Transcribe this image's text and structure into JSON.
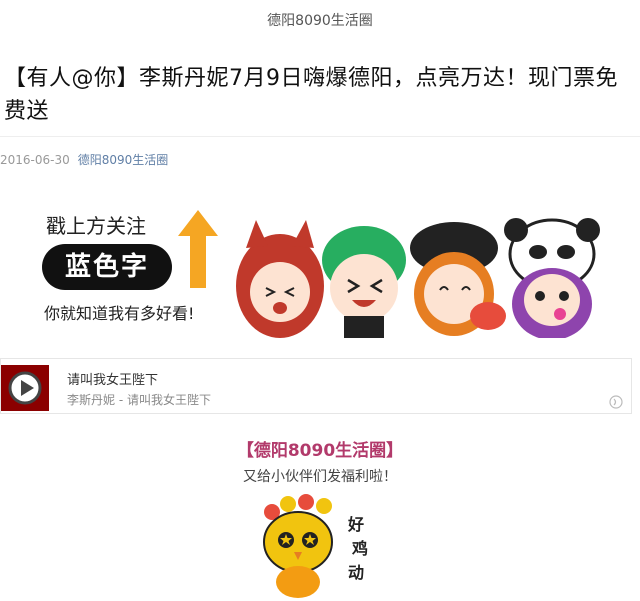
{
  "header": {
    "account_name": "德阳8090生活圈"
  },
  "article": {
    "title": "【有人@你】李斯丹妮7月9日嗨爆德阳，点亮万达！现门票免费送",
    "date": "2016-06-30",
    "author_link": "德阳8090生活圈"
  },
  "banner": {
    "line1": "戳上方关注",
    "pill": "蓝色字",
    "line2": "你就知道我有多好看!"
  },
  "audio": {
    "title": "请叫我女王陛下",
    "subtitle": "李斯丹妮 - 请叫我女王陛下"
  },
  "promo": {
    "brand": "【德阳8090生活圈】",
    "subtitle": "又给小伙伴们发福利啦！",
    "sticker_text": "好鸡动"
  },
  "colors": {
    "brand_text": "#b23a6b",
    "link": "#607fa6",
    "arrow": "#f5a623"
  }
}
